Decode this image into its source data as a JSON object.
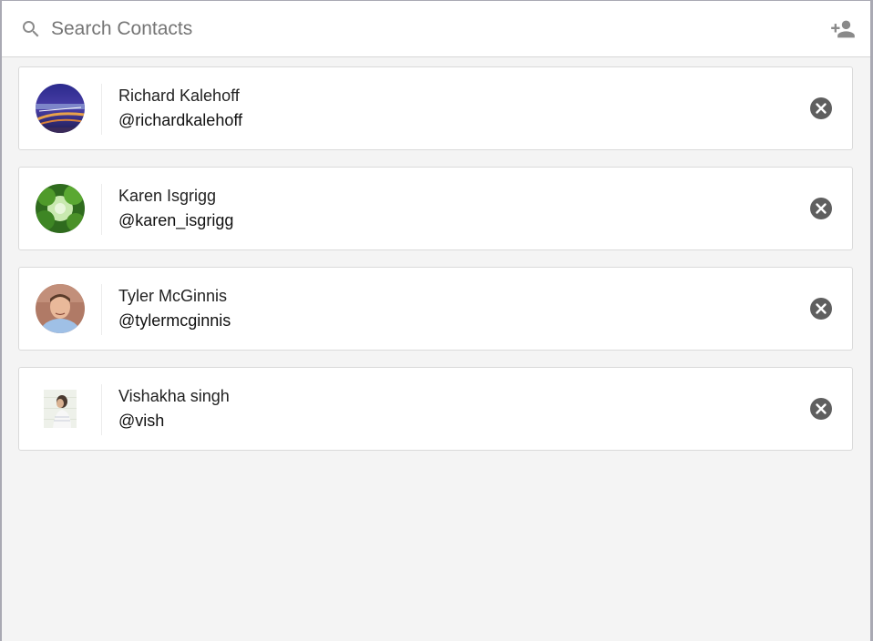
{
  "search": {
    "placeholder": "Search Contacts",
    "value": "",
    "icon": "search-icon",
    "add_icon": "add-contact-icon"
  },
  "contacts": [
    {
      "name": "Richard Kalehoff",
      "handle": "@richardkalehoff",
      "avatar": "city-bridge-night-photo"
    },
    {
      "name": "Karen Isgrigg",
      "handle": "@karen_isgrigg",
      "avatar": "green-tree-canopy-photo"
    },
    {
      "name": "Tyler McGinnis",
      "handle": "@tylermcginnis",
      "avatar": "man-portrait-photo"
    },
    {
      "name": "Vishakha singh",
      "handle": "@vish",
      "avatar": "woman-portrait-photo"
    }
  ],
  "colors": {
    "background": "#f4f4f4",
    "card": "#ffffff",
    "remove_icon": "#5f5f5f",
    "icon_gray": "#8a8a8a"
  }
}
